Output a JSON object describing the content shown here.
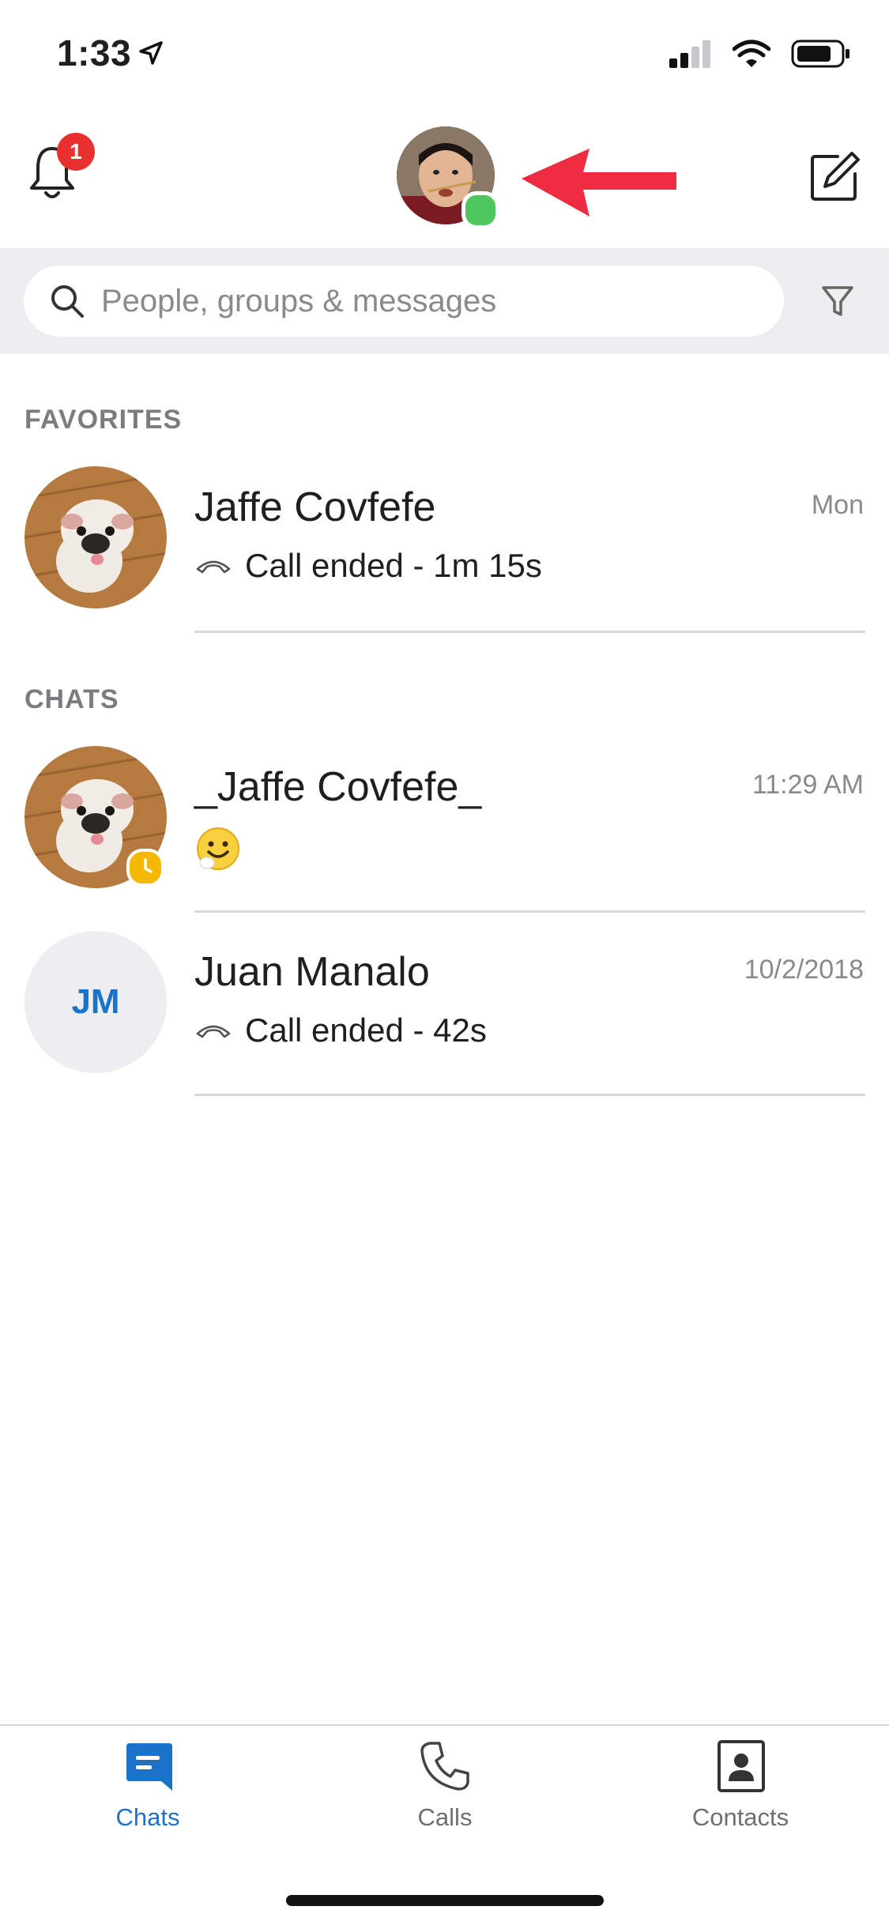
{
  "status_bar": {
    "time": "1:33"
  },
  "header": {
    "notification_count": "1"
  },
  "search": {
    "placeholder": "People, groups & messages"
  },
  "sections": {
    "favorites": "FAVORITES",
    "chats": "CHATS"
  },
  "favorites": [
    {
      "name": "Jaffe Covfefe",
      "time": "Mon",
      "subtitle": "Call ended - 1m 15s"
    }
  ],
  "chats": [
    {
      "name": "_Jaffe Covfefe_",
      "time": "11:29 AM",
      "subtitle": ""
    },
    {
      "name": "Juan Manalo",
      "time": "10/2/2018",
      "subtitle": "Call ended - 42s",
      "initials": "JM"
    }
  ],
  "tabs": [
    {
      "label": "Chats",
      "active": true
    },
    {
      "label": "Calls",
      "active": false
    },
    {
      "label": "Contacts",
      "active": false
    }
  ],
  "colors": {
    "accent": "#1a73c8",
    "badge": "#e8312f",
    "online": "#4fc660",
    "away": "#f5b800"
  }
}
